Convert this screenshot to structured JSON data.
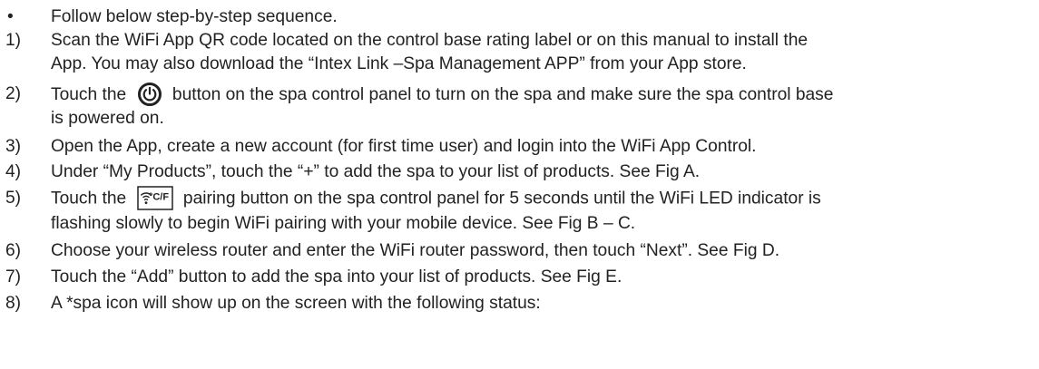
{
  "bullet": {
    "marker": "•",
    "text": "Follow below step-by-step sequence."
  },
  "steps": [
    {
      "number": "1)",
      "line1": "Scan the WiFi App QR code located on the control base rating label or on this manual to install the",
      "line2": "App. You may also download the “Intex Link –Spa Management APP” from your App store."
    },
    {
      "number": "2)",
      "before_icon": "Touch the",
      "icon": "power-icon",
      "after_icon": "button on the spa control panel to turn on the spa and make sure the spa control base",
      "line2": "is powered on."
    },
    {
      "number": "3)",
      "line1": "Open the App, create a new account (for first time user) and login into the WiFi App Control."
    },
    {
      "number": "4)",
      "line1": "Under “My Products”, touch the “+” to add the spa to your list of products. See Fig A."
    },
    {
      "number": "5)",
      "before_icon": "Touch the",
      "icon": "wifi-pairing-icon",
      "icon_text": "°C/F",
      "after_icon": "pairing button on the spa control panel for 5 seconds until the WiFi LED indicator is",
      "line2": "flashing slowly to begin WiFi pairing with your mobile device. See Fig B – C."
    },
    {
      "number": "6)",
      "line1": "Choose your wireless router and enter the WiFi router password, then touch “Next”. See Fig D."
    },
    {
      "number": "7)",
      "line1": "Touch the “Add” button to add the spa into your list of products. See Fig E."
    },
    {
      "number": "8)",
      "line1": "A *spa icon will show up on the screen with the following status:"
    }
  ]
}
